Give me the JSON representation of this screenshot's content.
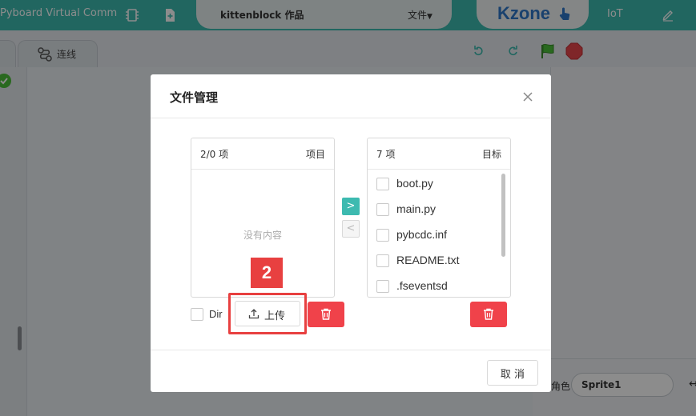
{
  "topbar": {
    "app_title": "Pyboard Virtual Comm",
    "project_name": "kittenblock 作品",
    "file_menu": "文件",
    "brand": "Kzone",
    "iot": "IoT"
  },
  "toolbar": {
    "connect_tab": "连线"
  },
  "sprite": {
    "label": "角色",
    "name": "Sprite1"
  },
  "modal": {
    "title": "文件管理",
    "source": {
      "count": "2/0 项",
      "title": "项目",
      "empty": "没有内容"
    },
    "target": {
      "count": "7 项",
      "title": "目标",
      "items": [
        "boot.py",
        "main.py",
        "pybcdc.inf",
        "README.txt",
        ".fseventsd"
      ]
    },
    "dir_label": "Dir",
    "upload_label": "上传",
    "cancel_label": "取 消",
    "step_badge": "2"
  },
  "colors": {
    "accent": "#3dbab0",
    "danger": "#f0424a",
    "highlight": "#e84040",
    "brand": "#2e77c8"
  },
  "icons": [
    "chip-icon",
    "new-file-icon",
    "hand-pointer-icon",
    "pen-icon",
    "connect-icon",
    "undo-icon",
    "redo-icon",
    "green-flag-icon",
    "stop-icon",
    "close-icon",
    "chevron-right-icon",
    "chevron-left-icon",
    "upload-icon",
    "trash-icon"
  ]
}
